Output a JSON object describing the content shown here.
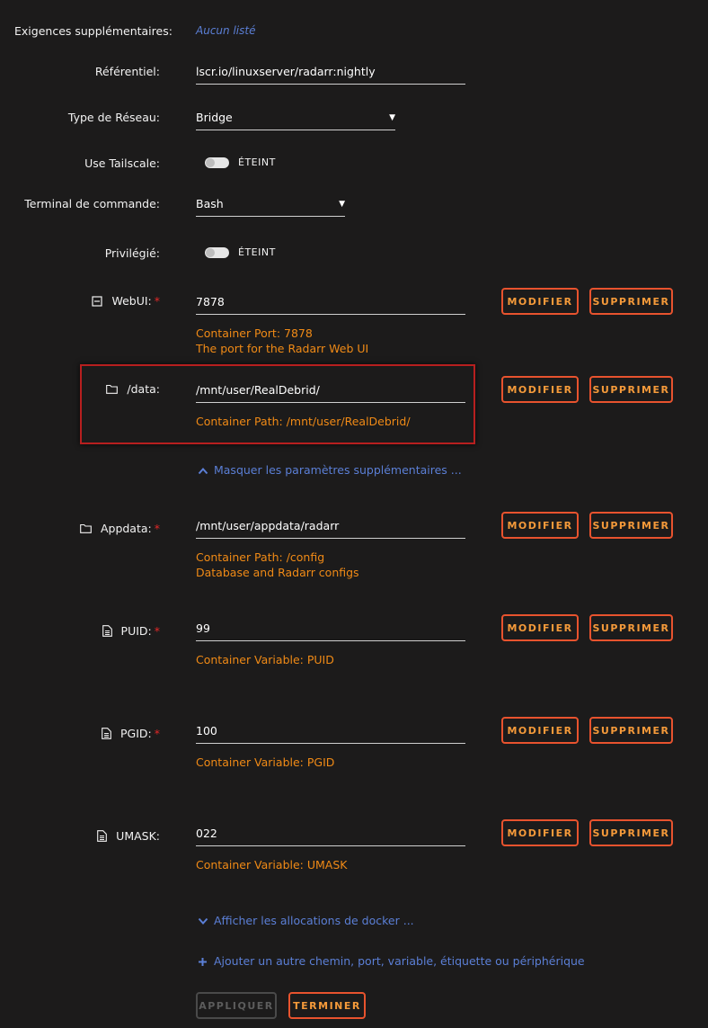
{
  "rows": {
    "exigences": {
      "label": "Exigences supplémentaires:",
      "value": "Aucun listé"
    },
    "referentiel": {
      "label": "Référentiel:",
      "value": "lscr.io/linuxserver/radarr:nightly"
    },
    "reseau": {
      "label": "Type de Réseau:",
      "value": "Bridge"
    },
    "tailscale": {
      "label": "Use Tailscale:",
      "state": "ÉTEINT"
    },
    "terminal": {
      "label": "Terminal de commande:",
      "value": "Bash"
    },
    "privilegie": {
      "label": "Privilégié:",
      "state": "ÉTEINT"
    }
  },
  "configs": [
    {
      "label": "WebUI:",
      "icon": "port-icon",
      "required": true,
      "value": "7878",
      "notes": [
        "Container Port: 7878",
        "The port for the Radarr Web UI"
      ]
    },
    {
      "label": "/data:",
      "icon": "folder-icon",
      "required": false,
      "value": "/mnt/user/RealDebrid/",
      "notes": [
        "Container Path: /mnt/user/RealDebrid/"
      ]
    },
    {
      "label": "Appdata:",
      "icon": "folder-icon",
      "required": true,
      "value": "/mnt/user/appdata/radarr",
      "notes": [
        "Container Path: /config",
        "Database and Radarr configs"
      ]
    },
    {
      "label": "PUID:",
      "icon": "file-icon",
      "required": true,
      "value": "99",
      "notes": [
        "Container Variable: PUID"
      ]
    },
    {
      "label": "PGID:",
      "icon": "file-icon",
      "required": true,
      "value": "100",
      "notes": [
        "Container Variable: PGID"
      ]
    },
    {
      "label": "UMASK:",
      "icon": "file-icon",
      "required": false,
      "value": "022",
      "notes": [
        "Container Variable: UMASK"
      ]
    }
  ],
  "required_mark": "*",
  "buttons": {
    "modify": "MODIFIER",
    "delete": "SUPPRIMER",
    "apply": "APPLIQUER",
    "done": "TERMINER"
  },
  "links": {
    "hide_advanced": "Masquer les paramètres supplémentaires ...",
    "show_allocations": "Afficher les allocations de docker ...",
    "add_more": "Ajouter un autre chemin, port, variable, étiquette ou périphérique"
  },
  "colors": {
    "accent": "#e8532e",
    "note": "#f08a16",
    "link": "#5b7fd6",
    "highlight": "#b71f1f"
  }
}
